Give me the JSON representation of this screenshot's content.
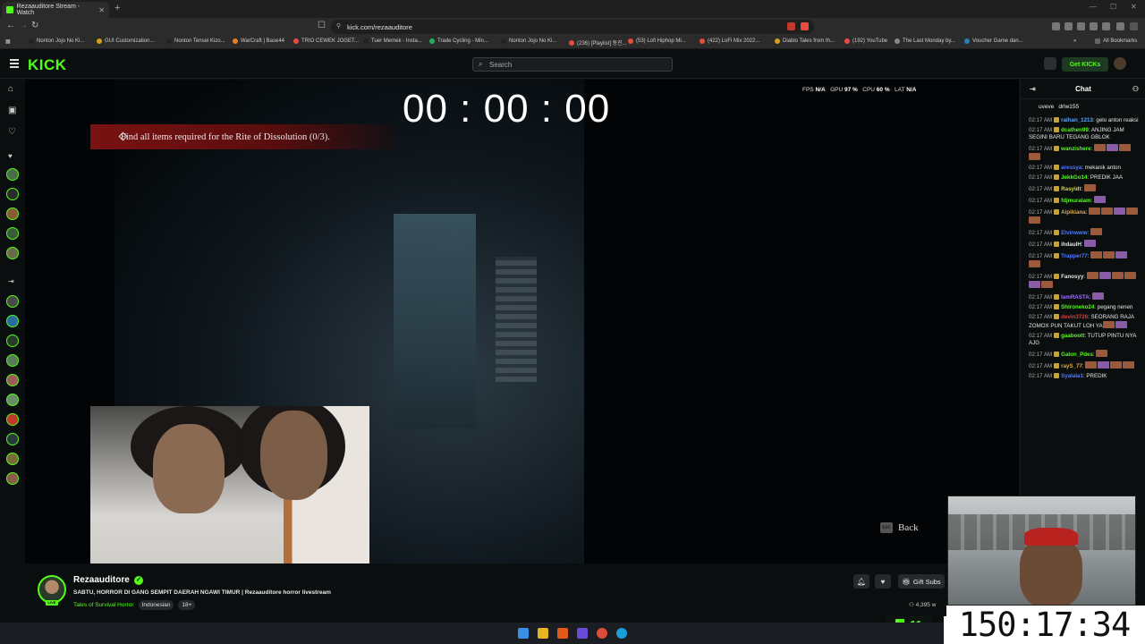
{
  "browser": {
    "tab_title": "Rezaauditore Stream - Watch",
    "url": "kick.com/rezaauditore",
    "bookmarks": [
      "Nonton Jojo No Ki...",
      "GUI Customization...",
      "Nonton Tensei Kizo...",
      "WarCraft | Base44",
      "TRIO CEWEK JOGET...",
      "Tuer Memek - Insta...",
      "Trade Cycling - Min...",
      "Nonton Jojo No Ki...",
      "(236) [Playlist] 동진...",
      "(53) Lofi Hiphop Mi...",
      "(422) LoFi Mix 2022...",
      "Diablo Tales from th...",
      "(192) YouTube",
      "The Last Monday by...",
      "Voucher Game dan..."
    ],
    "all_bookmarks": "All Bookmarks"
  },
  "header": {
    "logo": "KICK",
    "search_placeholder": "Search",
    "get_kicks": "Get KICKs"
  },
  "game": {
    "timer": "00 : 00 : 00",
    "objective": "Find all items required for the Rite of Dissolution (0/3).",
    "stats": {
      "fps_label": "FPS",
      "fps_value": "N/A",
      "gpu_label": "GPU",
      "gpu_value": "97 %",
      "cpu_label": "CPU",
      "cpu_value": "60 %",
      "lat_label": "LAT",
      "lat_value": "N/A"
    },
    "back_key": "ESC",
    "back_label": "Back"
  },
  "chat": {
    "title": "Chat",
    "pinned": [
      "uveve",
      "drlw155"
    ],
    "messages": [
      {
        "time": "02:17 AM",
        "user": "raihan_1213",
        "color": "#58a6ff",
        "text": "gelo anton reaksi",
        "emotes": 0
      },
      {
        "time": "02:17 AM",
        "user": "dcathen99",
        "color": "#53fc18",
        "text": "ANJING JAM SEGINI BARU TEGANG GBLOK",
        "emotes": 0
      },
      {
        "time": "02:17 AM",
        "user": "wanzishere",
        "color": "#53fc18",
        "text": "",
        "emotes": 4
      },
      {
        "time": "02:17 AM",
        "user": "aressya",
        "color": "#4f7cff",
        "text": "mekanik anton",
        "emotes": 0
      },
      {
        "time": "02:17 AM",
        "user": "JekkGo14",
        "color": "#53fc18",
        "text": "PREDIK JAA",
        "emotes": 0
      },
      {
        "time": "02:17 AM",
        "user": "Rasyidt",
        "color": "#d6d64a",
        "text": "",
        "emotes": 1
      },
      {
        "time": "02:17 AM",
        "user": "fdjmuralam",
        "color": "#53fc18",
        "text": "",
        "emotes": 1
      },
      {
        "time": "02:17 AM",
        "user": "Aipikiana",
        "color": "#e5a83a",
        "text": "",
        "emotes": 5
      },
      {
        "time": "02:17 AM",
        "user": "Elvinwww",
        "color": "#4f7cff",
        "text": "",
        "emotes": 1
      },
      {
        "time": "02:17 AM",
        "user": "ihdaulH",
        "color": "#e6e6e6",
        "text": "",
        "emotes": 1
      },
      {
        "time": "02:17 AM",
        "user": "Trapper77",
        "color": "#4f7cff",
        "text": "",
        "emotes": 4
      },
      {
        "time": "02:17 AM",
        "user": "Fanosyy",
        "color": "#e6e6e6",
        "text": "",
        "emotes": 6
      },
      {
        "time": "02:17 AM",
        "user": "IamRASTA",
        "color": "#a06bff",
        "text": "",
        "emotes": 1
      },
      {
        "time": "02:17 AM",
        "user": "Shironeko24",
        "color": "#53fc18",
        "text": "pegang nenen",
        "emotes": 0
      },
      {
        "time": "02:17 AM",
        "user": "devin3726",
        "color": "#e03a3a",
        "text": "SEORANG RAJA ZOMOX PUN TAKUT LOH YA",
        "emotes": 2
      },
      {
        "time": "02:17 AM",
        "user": "gaaboott",
        "color": "#53fc18",
        "text": "TUTUP PINTU NYA AJG",
        "emotes": 0
      },
      {
        "time": "02:17 AM",
        "user": "Galon_Pdes",
        "color": "#53fc18",
        "text": "",
        "emotes": 1
      },
      {
        "time": "02:17 AM",
        "user": "rayS_77",
        "color": "#e5a83a",
        "text": "",
        "emotes": 4
      },
      {
        "time": "02:17 AM",
        "user": "Syalala1",
        "color": "#4f7cff",
        "text": "PREDIK",
        "emotes": 0
      }
    ]
  },
  "stream": {
    "streamer": "Rezaauditore",
    "title": "SABTU, HORROR DI GANG SEMPIT DAERAH NGAWI TIMUR | Rezaauditore horror livestream",
    "category": "Tales of Survival Horror",
    "tags": [
      "Indonesian",
      "18+"
    ],
    "gift_subs": "Gift Subs",
    "viewers": "4,395 w"
  },
  "overlay": {
    "uptime": "150:17:34",
    "viewer_badge": "11"
  },
  "colors": {
    "brand": "#53fc18",
    "objective_bg": "#7a1212",
    "bg": "#0b0e0f"
  }
}
